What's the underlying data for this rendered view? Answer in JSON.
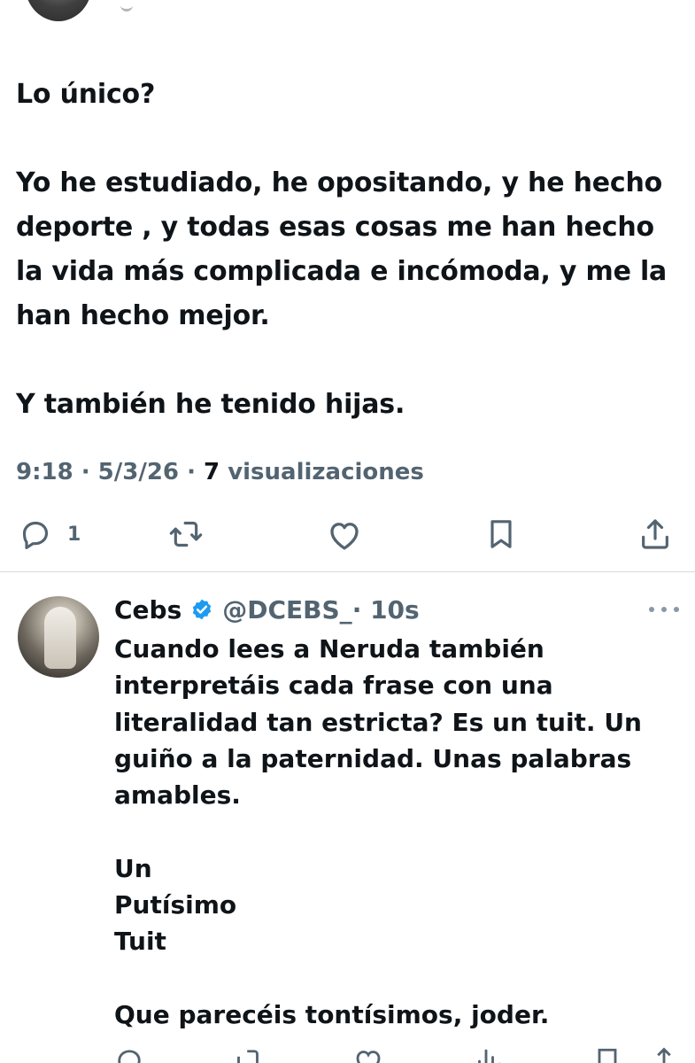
{
  "main_tweet": {
    "text": "Lo único?\n\nYo he estudiado, he opositando, y he hecho deporte , y todas esas cosas me han hecho la vida más complicada e incómoda, y me la han hecho mejor.\n\nY también he tenido hijas.",
    "time": "9:18",
    "date": "5/3/26",
    "views_count": "7",
    "views_label": "visualizaciones",
    "reply_count": "1"
  },
  "reply": {
    "name": "Cebs",
    "handle": "@DCEBS_",
    "time": "· 10s",
    "text": "Cuando lees a Neruda también interpretáis cada frase con una literalidad tan estricta? Es un tuit. Un guiño a la paternidad. Unas palabras amables.\n\nUn\nPutísimo\nTuit\n\nQue parecéis tontísimos, joder."
  },
  "icons": [
    "reply-icon",
    "retweet-icon",
    "like-icon",
    "bookmark-icon",
    "share-icon",
    "verified-badge-icon",
    "more-icon",
    "views-icon"
  ],
  "colors": {
    "text": "#0f1419",
    "muted": "#536471",
    "verified": "#1d9bf0",
    "divider": "#d6dadd"
  }
}
